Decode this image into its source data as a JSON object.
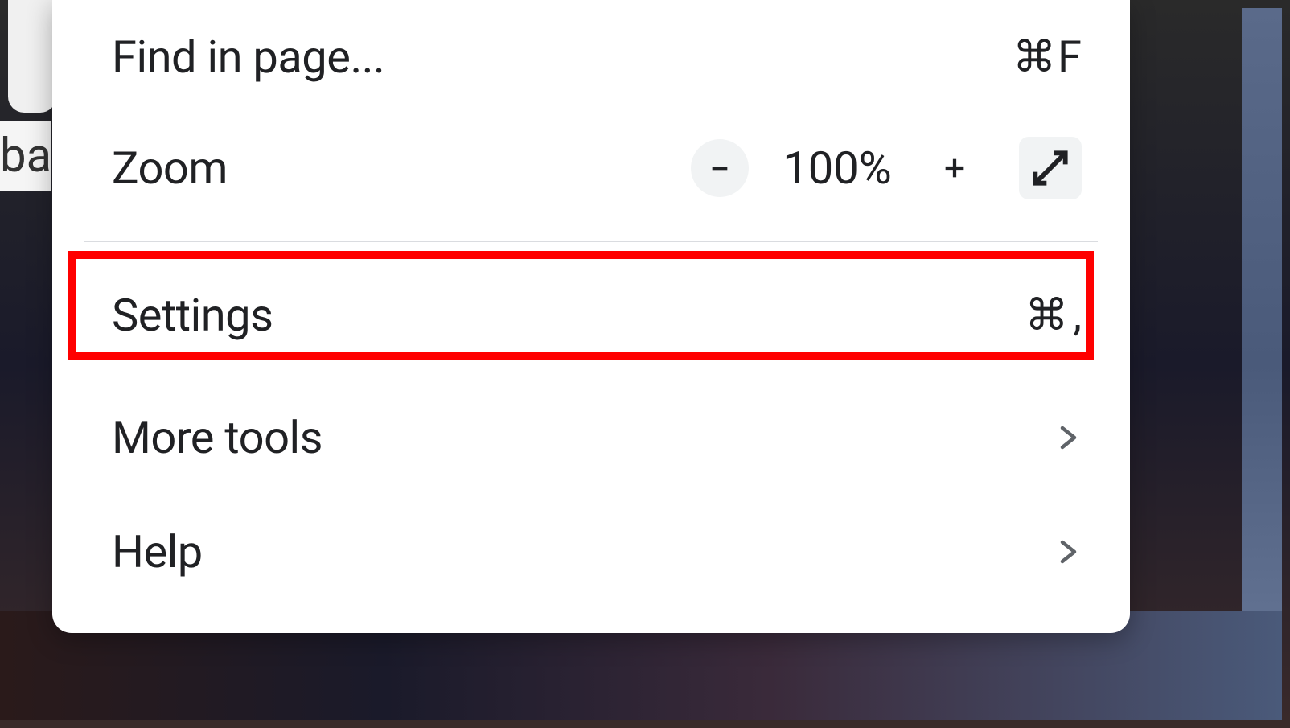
{
  "backdrop": {
    "partial_text": "ba"
  },
  "menu": {
    "find_in_page": {
      "label": "Find in page...",
      "shortcut_symbol": "⌘",
      "shortcut_key": "F"
    },
    "zoom": {
      "label": "Zoom",
      "value": "100%"
    },
    "settings": {
      "label": "Settings",
      "shortcut_symbol": "⌘",
      "shortcut_key": ","
    },
    "more_tools": {
      "label": "More tools"
    },
    "help": {
      "label": "Help"
    }
  },
  "highlight": {
    "target": "settings"
  }
}
